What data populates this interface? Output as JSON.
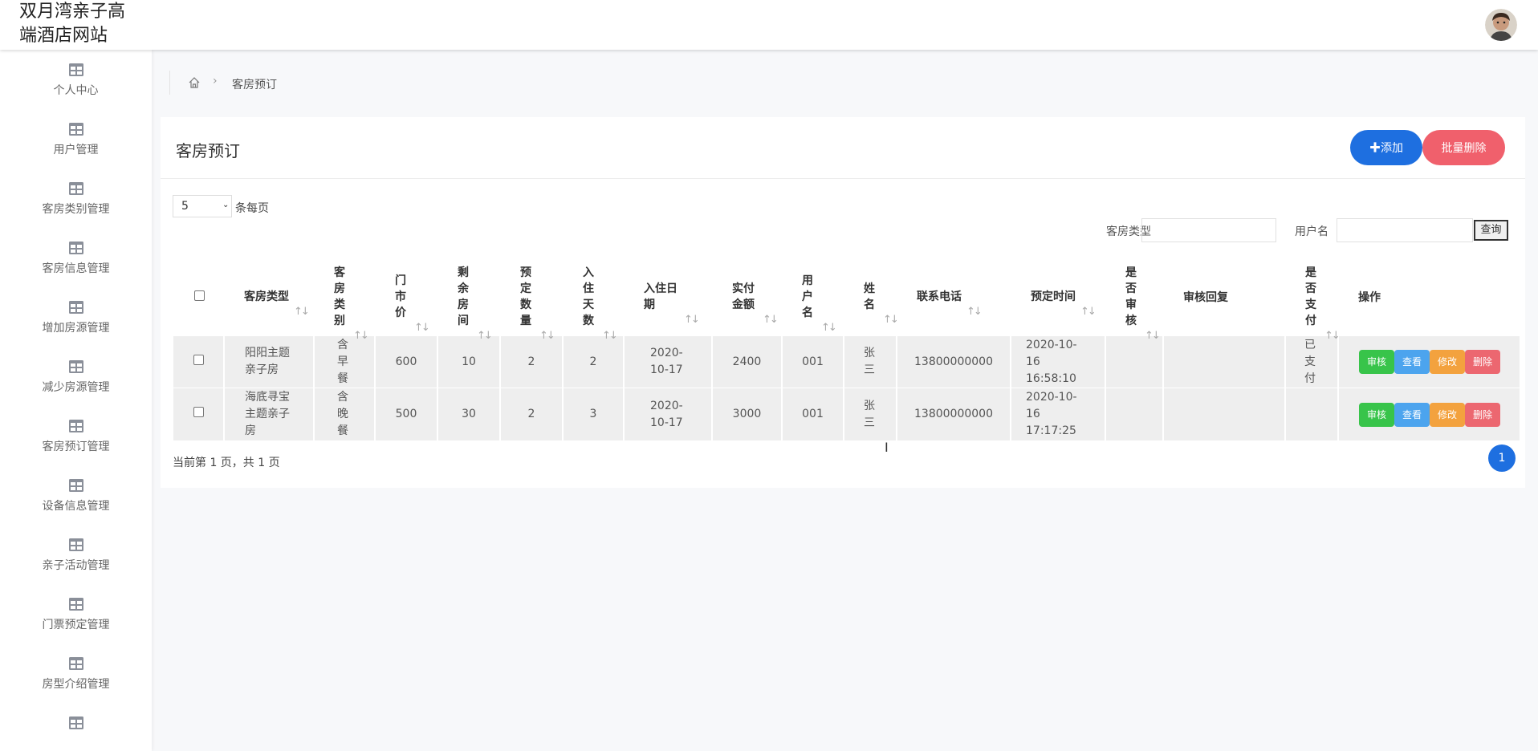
{
  "site": {
    "title": "双月湾亲子高端酒店网站"
  },
  "header": {
    "avatar_alt": "user-avatar"
  },
  "sidebar": {
    "items": [
      {
        "label": "个人中心"
      },
      {
        "label": "用户管理"
      },
      {
        "label": "客房类别管理"
      },
      {
        "label": "客房信息管理"
      },
      {
        "label": "增加房源管理"
      },
      {
        "label": "减少房源管理"
      },
      {
        "label": "客房预订管理"
      },
      {
        "label": "设备信息管理"
      },
      {
        "label": "亲子活动管理"
      },
      {
        "label": "门票预定管理"
      },
      {
        "label": "房型介绍管理"
      },
      {
        "label": ""
      }
    ]
  },
  "breadcrumb": {
    "current": "客房预订"
  },
  "card": {
    "title": "客房预订",
    "add_label": "✚添加",
    "batch_delete_label": "批量删除"
  },
  "pagination": {
    "page_size": "5",
    "per_page_label": "条每页",
    "summary": "当前第 1 页，共 1 页",
    "current_page": "1"
  },
  "search": {
    "room_type_label": "客房类型",
    "room_type_value": "",
    "username_label": "用户名",
    "username_value": "",
    "query_label": "查询"
  },
  "table": {
    "columns": [
      "客房类型",
      "客房类别",
      "门市价",
      "剩余房间",
      "预定数量",
      "入住天数",
      "入住日期",
      "实付金额",
      "用户名",
      "姓名",
      "联系电话",
      "预定时间",
      "是否审核",
      "审核回复",
      "是否支付",
      "操作"
    ],
    "rows": [
      [
        "阳阳主题亲子房",
        "含早餐",
        "600",
        "10",
        "2",
        "2",
        "2020-10-17",
        "2400",
        "001",
        "张三",
        "13800000000",
        "2020-10-16 16:58:10",
        "",
        "",
        "已支付"
      ],
      [
        "海底寻宝主题亲子房",
        "含晚餐",
        "500",
        "30",
        "2",
        "3",
        "2020-10-17",
        "3000",
        "001",
        "张三",
        "13800000000",
        "2020-10-16 17:17:25",
        "",
        "",
        ""
      ]
    ],
    "actions": {
      "review": "审核",
      "view": "查看",
      "edit": "修改",
      "delete": "删除"
    }
  }
}
